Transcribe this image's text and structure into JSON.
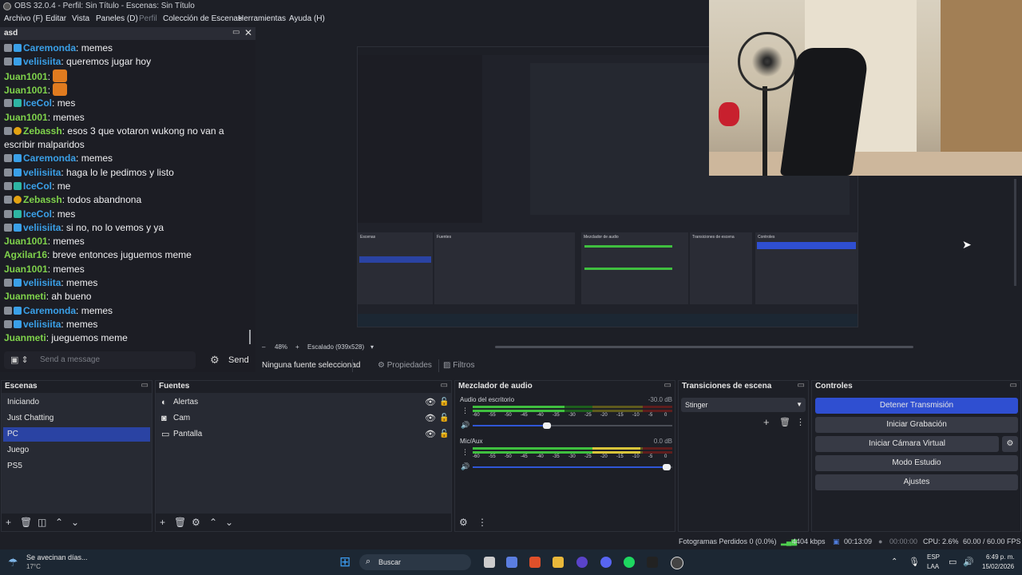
{
  "window": {
    "title": "OBS 32.0.4 - Perfil: Sin Título - Escenas: Sin Título"
  },
  "menu": {
    "archivo": "Archivo (F)",
    "editar": "Editar",
    "vista": "Vista",
    "paneles": "Paneles (D)",
    "perfil": "Perfil",
    "coleccion": "Colección de Escenas",
    "herramientas": "Herramientas",
    "ayuda": "Ayuda (H)"
  },
  "chat": {
    "title": "asd",
    "messages": [
      {
        "user": "Caremonda",
        "color": "#3aa0e8",
        "badge": "b-blue",
        "text": "memes"
      },
      {
        "user": "veliisiita",
        "color": "#3aa0e8",
        "badge": "b-blue",
        "text": "queremos jugar hoy"
      },
      {
        "user": "Juan1001",
        "color": "#7fd24b",
        "badge": "",
        "text": "",
        "emote": true
      },
      {
        "user": "Juan1001",
        "color": "#7fd24b",
        "badge": "",
        "text": "",
        "emote": true
      },
      {
        "user": "IceCol",
        "color": "#3aa0e8",
        "badge": "b-teal",
        "text": "mes"
      },
      {
        "user": "Juan1001",
        "color": "#7fd24b",
        "badge": "",
        "text": "memes"
      },
      {
        "user": "Zebassh",
        "color": "#7fd24b",
        "badge": "b-yellow",
        "text": "esos 3 que votaron wukong no van a escribir malparidos"
      },
      {
        "user": "Caremonda",
        "color": "#3aa0e8",
        "badge": "b-blue",
        "text": "memes"
      },
      {
        "user": "veliisiita",
        "color": "#3aa0e8",
        "badge": "b-blue",
        "text": "haga lo le pedimos y listo"
      },
      {
        "user": "IceCol",
        "color": "#3aa0e8",
        "badge": "b-teal",
        "text": "me"
      },
      {
        "user": "Zebassh",
        "color": "#7fd24b",
        "badge": "b-yellow",
        "text": "todos abandnona"
      },
      {
        "user": "IceCol",
        "color": "#3aa0e8",
        "badge": "b-teal",
        "text": "mes"
      },
      {
        "user": "veliisiita",
        "color": "#3aa0e8",
        "badge": "b-blue",
        "text": "si no, no lo vemos y ya"
      },
      {
        "user": "Juan1001",
        "color": "#7fd24b",
        "badge": "",
        "text": "memes"
      },
      {
        "user": "Agxilar16",
        "color": "#7fd24b",
        "badge": "",
        "text": "breve entonces juguemos meme"
      },
      {
        "user": "Juan1001",
        "color": "#7fd24b",
        "badge": "",
        "text": "memes"
      },
      {
        "user": "veliisiita",
        "color": "#3aa0e8",
        "badge": "b-blue",
        "text": "memes"
      },
      {
        "user": "Juanmeti",
        "color": "#7fd24b",
        "badge": "",
        "text": "ah bueno"
      },
      {
        "user": "Caremonda",
        "color": "#3aa0e8",
        "badge": "b-blue",
        "text": "memes"
      },
      {
        "user": "veliisiita",
        "color": "#3aa0e8",
        "badge": "b-blue",
        "text": "memes"
      },
      {
        "user": "Juanmeti",
        "color": "#7fd24b",
        "badge": "",
        "text": "jueguemos meme"
      }
    ],
    "input_placeholder": "Send a message",
    "send": "Send"
  },
  "preview": {
    "zoom": "48%",
    "scale": "Escalado (939x528)",
    "nested_labels": {
      "escenas": "Escenas",
      "fuentes": "Fuentes",
      "mezclador": "Mezclador de audio",
      "transiciones": "Transiciones de escena",
      "controles": "Controles"
    }
  },
  "props": {
    "no_source": "Ninguna fuente seleccionad",
    "properties": "Propiedades",
    "filters": "Filtros"
  },
  "scenes": {
    "title": "Escenas",
    "items": [
      "Iniciando",
      "Just Chatting",
      "PC",
      "Juego",
      "PS5"
    ],
    "selected": 2
  },
  "sources": {
    "title": "Fuentes",
    "items": [
      {
        "icon": "◐",
        "name": "Alertas"
      },
      {
        "icon": "◙",
        "name": "Cam"
      },
      {
        "icon": "▭",
        "name": "Pantalla"
      }
    ]
  },
  "mixer": {
    "title": "Mezclador de audio",
    "channels": [
      {
        "name": "Audio del escritorio",
        "db": "-30.0 dB",
        "level": 0.46,
        "volume": 0.37
      },
      {
        "name": "Mic/Aux",
        "db": "0.0 dB",
        "level": 0.84,
        "volume": 0.97
      }
    ],
    "ticks": [
      "-60",
      "-55",
      "-50",
      "-45",
      "-40",
      "-35",
      "-30",
      "-25",
      "-20",
      "-15",
      "-10",
      "-5",
      "0"
    ]
  },
  "transitions": {
    "title": "Transiciones de escena",
    "selected": "Stinger"
  },
  "controls": {
    "title": "Controles",
    "stop_stream": "Detener Transmisión",
    "start_rec": "Iniciar Grabación",
    "virtual_cam": "Iniciar Cámara Virtual",
    "studio": "Modo Estudio",
    "settings": "Ajustes"
  },
  "status": {
    "dropped": "Fotogramas Perdidos 0 (0.0%)",
    "kbps": "4404 kbps",
    "live_time": "00:13:09",
    "rec_time": "00:00:00",
    "cpu": "CPU: 2.6%",
    "fps": "60.00 / 60.00 FPS"
  },
  "taskbar": {
    "weather_text": "Se avecinan días...",
    "temp": "17°C",
    "search": "Buscar",
    "lang": "ESP",
    "lang2": "LAA",
    "time": "6:49 p. m.",
    "date": "15/02/2026"
  }
}
